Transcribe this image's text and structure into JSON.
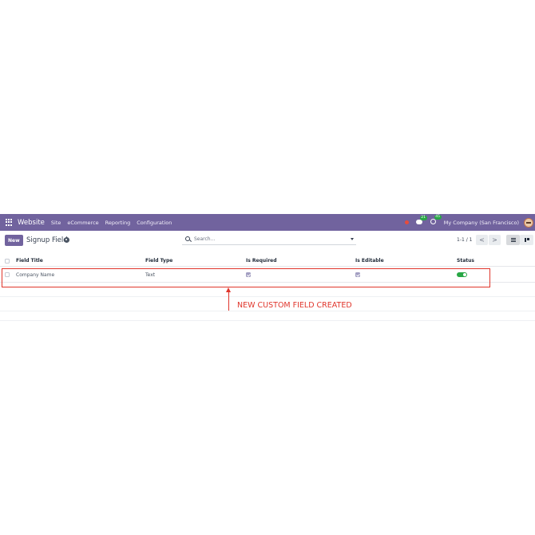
{
  "navbar": {
    "brand": "Website",
    "menu": [
      "Site",
      "eCommerce",
      "Reporting",
      "Configuration"
    ],
    "chat_badge": "21",
    "activity_badge": "45",
    "company": "My Company (San Francisco)"
  },
  "control_panel": {
    "new_label": "New",
    "breadcrumb": "Signup Field",
    "search_placeholder": "Search...",
    "pager": "1-1 / 1",
    "prev": "<",
    "next": ">"
  },
  "list": {
    "columns": [
      "Field Title",
      "Field Type",
      "Is Required",
      "Is Editable",
      "Status"
    ],
    "rows": [
      {
        "field_title": "Company Name",
        "field_type": "Text",
        "is_required": true,
        "is_editable": true,
        "status": true
      }
    ]
  },
  "annotation": {
    "text": "NEW CUSTOM FIELD CREATED",
    "color": "#e0352b"
  },
  "colors": {
    "navbar": "#71639e",
    "accent": "#71639e",
    "status_on": "#28a745"
  }
}
